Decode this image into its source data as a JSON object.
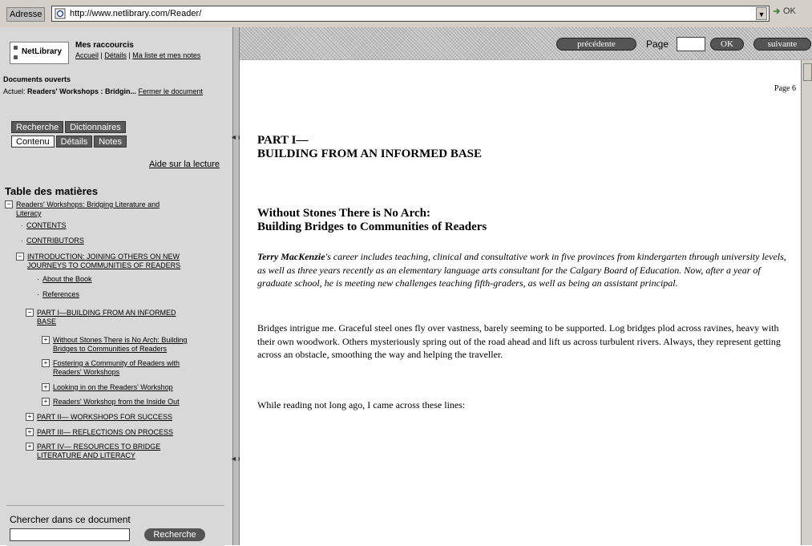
{
  "address_bar": {
    "label": "Adresse",
    "url": "http://www.netlibrary.com/Reader/",
    "go_label": "OK"
  },
  "sidebar": {
    "logo_text": "NetLibrary",
    "shortcuts_title": "Mes raccourcis",
    "shortcuts_links": [
      "Accueil",
      "Détails",
      "Ma liste et mes notes"
    ],
    "open_docs_title": "Documents ouverts",
    "current_doc_prefix": "Actuel: ",
    "current_doc_title": "Readers' Workshops : Bridgin...",
    "close_doc_link": "Fermer le document",
    "tabs_row1": [
      "Recherche",
      "Dictionnaires"
    ],
    "tabs_row2": [
      "Contenu",
      "Détails",
      "Notes"
    ],
    "help_link": "Aide sur la lecture",
    "toc_title": "Table des matières",
    "toc": [
      {
        "box": "−",
        "label": "Readers' Workshops: Bridging Literature and",
        "label2": "Literacy"
      },
      {
        "box": "",
        "label": "CONTENTS"
      },
      {
        "box": "",
        "label": "CONTRIBUTORS"
      },
      {
        "box": "−",
        "label": "INTRODUCTION: JOINING OTHERS ON NEW",
        "label2": "JOURNEYS TO COMMUNITIES OF READERS"
      },
      {
        "box": "",
        "label": "About the Book"
      },
      {
        "box": "",
        "label": "References"
      },
      {
        "box": "−",
        "label": "PART I—BUILDING FROM AN INFORMED",
        "label2": "BASE"
      },
      {
        "box": "+",
        "label": "Without Stones There is No Arch: Building",
        "label2": "Bridges to Communities of Readers"
      },
      {
        "box": "+",
        "label": "Fostering a Community of Readers with",
        "label2": "Readers' Workshops"
      },
      {
        "box": "+",
        "label": "Looking in on the Readers' Workshop"
      },
      {
        "box": "+",
        "label": "Readers' Workshop from the Inside Out"
      },
      {
        "box": "+",
        "label": "PART II— WORKSHOPS FOR SUCCESS"
      },
      {
        "box": "+",
        "label": "PART III— REFLECTIONS ON PROCESS"
      },
      {
        "box": "+",
        "label": "PART IV— RESOURCES TO BRIDGE",
        "label2": "LITERATURE AND LITERACY"
      }
    ],
    "search_label": "Chercher dans ce document",
    "search_value": "",
    "search_button": "Recherche"
  },
  "nav": {
    "prev_label": "précédente",
    "page_label": "Page",
    "page_value": "",
    "ok_label": "OK",
    "next_label": "suivante"
  },
  "content": {
    "page_number": "Page 6",
    "part_title_line1": "PART I—",
    "part_title_line2": "BUILDING FROM AN INFORMED BASE",
    "section_title_line1": "Without Stones There is No Arch:",
    "section_title_line2": "Building Bridges to Communities of Readers",
    "intro_author": "Terry MacKenzie",
    "intro_text": "'s career includes teaching, clinical and consultative work in five provinces from kindergarten through university levels, as well as three years recently as an elementary language arts consultant for the Calgary Board of Education. Now, after a year of graduate school, he is meeting new challenges teaching fifth-graders, as well as being an assistant principal.",
    "paragraph1": "Bridges intrigue me. Graceful steel ones fly over vastness, barely seeming to be supported. Log bridges plod across ravines, heavy with their own woodwork. Others mysteriously spring out of the road ahead and lift us across turbulent rivers. Always, they represent getting across an obstacle, smoothing the way and helping the traveller.",
    "paragraph2": "While reading not long ago, I came across these lines:"
  }
}
